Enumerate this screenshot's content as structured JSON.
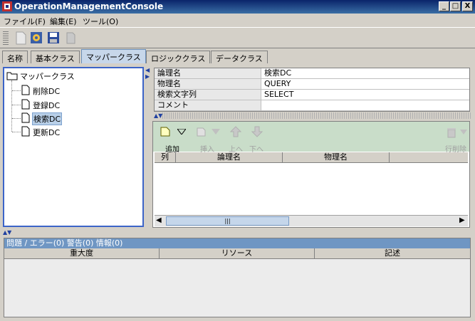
{
  "window": {
    "title": "OperationManagementConsole",
    "buttons": {
      "minimize": "_",
      "maximize": "□",
      "close": "X"
    }
  },
  "menu": [
    "ファイル(F)",
    "編集(E)",
    "ツール(O)"
  ],
  "tabs": [
    "名称",
    "基本クラス",
    "マッパークラス",
    "ロジッククラス",
    "データクラス"
  ],
  "active_tab": "マッパークラス",
  "tree": {
    "root": "マッパークラス",
    "children": [
      "削除DC",
      "登録DC",
      "検索DC",
      "更新DC"
    ],
    "selected": "検索DC"
  },
  "properties": [
    {
      "key": "論理名",
      "value": "検索DC"
    },
    {
      "key": "物理名",
      "value": "QUERY"
    },
    {
      "key": "検索文字列",
      "value": "SELECT"
    },
    {
      "key": "コメント",
      "value": ""
    }
  ],
  "row_toolbar": {
    "add": "追加",
    "insert": "挿入",
    "up": "上へ",
    "down": "下へ",
    "delete_row": "行削除"
  },
  "table_columns": [
    "列",
    "論理名",
    "物理名"
  ],
  "scroll_thumb_glyph": "|||",
  "problems": {
    "header": "問題 / エラー(0) 警告(0) 情報(0)",
    "columns": [
      "重大度",
      "リソース",
      "記述"
    ]
  },
  "colors": {
    "titlebar": "#0a246a",
    "active_tab": "#c7d7ea",
    "tree_border": "#3c64c8",
    "row_toolbar": "#c9ddc9",
    "problems_header": "#6f96c3"
  }
}
